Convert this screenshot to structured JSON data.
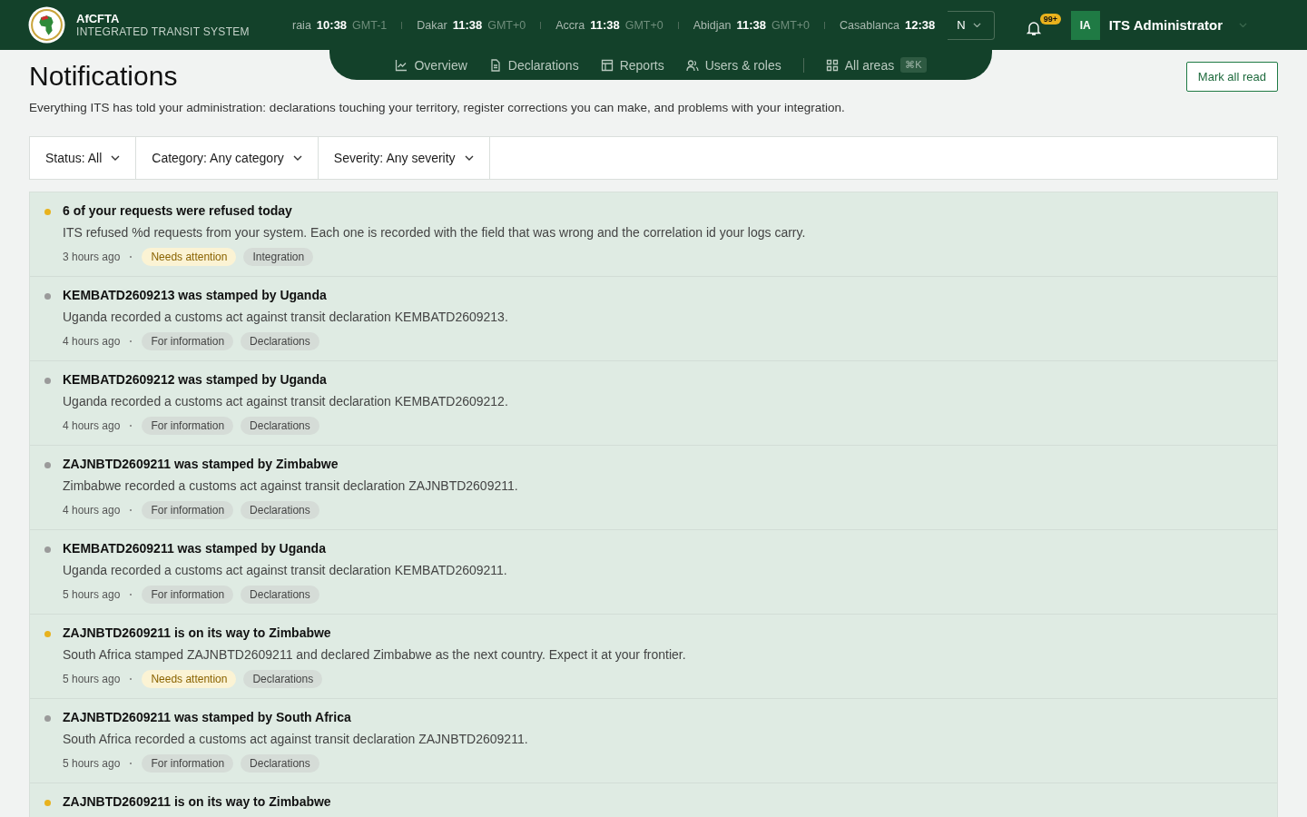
{
  "brand": {
    "name": "AfCFTA",
    "subtitle": "INTEGRATED TRANSIT SYSTEM"
  },
  "clocks": [
    {
      "city": "raia",
      "time": "10:38",
      "zone": "GMT-1"
    },
    {
      "city": "Dakar",
      "time": "11:38",
      "zone": "GMT+0"
    },
    {
      "city": "Accra",
      "time": "11:38",
      "zone": "GMT+0"
    },
    {
      "city": "Abidjan",
      "time": "11:38",
      "zone": "GMT+0"
    },
    {
      "city": "Casablanca",
      "time": "12:38"
    }
  ],
  "language": {
    "label": "N"
  },
  "notifications_badge": "99+",
  "user": {
    "initials": "IA",
    "name": "ITS Administrator"
  },
  "nav": [
    {
      "label": "Overview",
      "kind": "overview",
      "selected": false
    },
    {
      "label": "Declarations",
      "kind": "declarations",
      "selected": false
    },
    {
      "label": "Reports",
      "kind": "reports",
      "selected": false
    },
    {
      "label": "Users & roles",
      "kind": "users",
      "selected": false
    },
    {
      "label": "All areas",
      "kind": "areas",
      "selected": false,
      "shortcut": "⌘K"
    }
  ],
  "page": {
    "title": "Notifications",
    "description": "Everything ITS has told your administration: declarations touching your territory, register corrections you can make, and problems with your integration.",
    "action": "Mark all read"
  },
  "filters": [
    {
      "label": "Status: All"
    },
    {
      "label": "Category: Any category"
    },
    {
      "label": "Severity: Any severity"
    }
  ],
  "items": [
    {
      "title": "6 of your requests were refused today",
      "body": "ITS refused %d requests from your system. Each one is recorded with the field that was wrong and the correlation id your logs carry.",
      "time": "3 hours ago",
      "kind": "attention",
      "severity_label": "Needs attention",
      "category": "Integration"
    },
    {
      "title": "KEMBATD2609213 was stamped by Uganda",
      "body": "Uganda recorded a customs act against transit declaration KEMBATD2609213.",
      "time": "4 hours ago",
      "kind": "info",
      "severity_label": "For information",
      "category": "Declarations"
    },
    {
      "title": "KEMBATD2609212 was stamped by Uganda",
      "body": "Uganda recorded a customs act against transit declaration KEMBATD2609212.",
      "time": "4 hours ago",
      "kind": "info",
      "severity_label": "For information",
      "category": "Declarations"
    },
    {
      "title": "ZAJNBTD2609211 was stamped by Zimbabwe",
      "body": "Zimbabwe recorded a customs act against transit declaration ZAJNBTD2609211.",
      "time": "4 hours ago",
      "kind": "info",
      "severity_label": "For information",
      "category": "Declarations"
    },
    {
      "title": "KEMBATD2609211 was stamped by Uganda",
      "body": "Uganda recorded a customs act against transit declaration KEMBATD2609211.",
      "time": "5 hours ago",
      "kind": "info",
      "severity_label": "For information",
      "category": "Declarations"
    },
    {
      "title": "ZAJNBTD2609211 is on its way to Zimbabwe",
      "body": "South Africa stamped ZAJNBTD2609211 and declared Zimbabwe as the next country. Expect it at your frontier.",
      "time": "5 hours ago",
      "kind": "attention",
      "severity_label": "Needs attention",
      "category": "Declarations"
    },
    {
      "title": "ZAJNBTD2609211 was stamped by South Africa",
      "body": "South Africa recorded a customs act against transit declaration ZAJNBTD2609211.",
      "time": "5 hours ago",
      "kind": "info",
      "severity_label": "For information",
      "category": "Declarations"
    },
    {
      "title": "ZAJNBTD2609211 is on its way to Zimbabwe",
      "kind": "attention"
    }
  ]
}
